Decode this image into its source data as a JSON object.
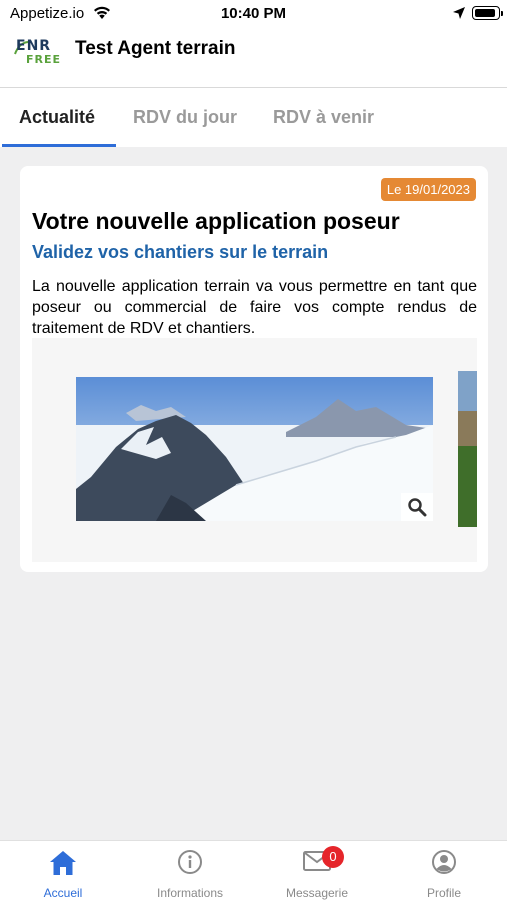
{
  "status_bar": {
    "carrier": "Appetize.io",
    "time": "10:40 PM"
  },
  "app_header": {
    "logo_line1": "ENR",
    "logo_line2": "FREE",
    "title": "Test Agent terrain"
  },
  "tabs": [
    {
      "label": "Actualité",
      "active": true
    },
    {
      "label": "RDV du jour",
      "active": false
    },
    {
      "label": "RDV à venir",
      "active": false
    }
  ],
  "news_card": {
    "date": "Le 19/01/2023",
    "title": "Votre nouvelle application poseur",
    "subtitle": "Validez vos chantiers sur le terrain",
    "body": "La nouvelle application terrain va vous permettre en tant que poseur ou commercial de faire vos compte rendus de traitement de RDV  et chantiers."
  },
  "bottom_nav": {
    "items": [
      {
        "label": "Accueil",
        "icon": "home-icon",
        "active": true
      },
      {
        "label": "Informations",
        "icon": "info-icon",
        "active": false
      },
      {
        "label": "Messagerie",
        "icon": "mail-icon",
        "active": false,
        "badge": "0"
      },
      {
        "label": "Profile",
        "icon": "user-icon",
        "active": false
      }
    ]
  },
  "colors": {
    "accent": "#2e6dd8",
    "badge_orange": "#e58934",
    "subtitle_blue": "#1f63a8",
    "notification_red": "#e5252a"
  }
}
